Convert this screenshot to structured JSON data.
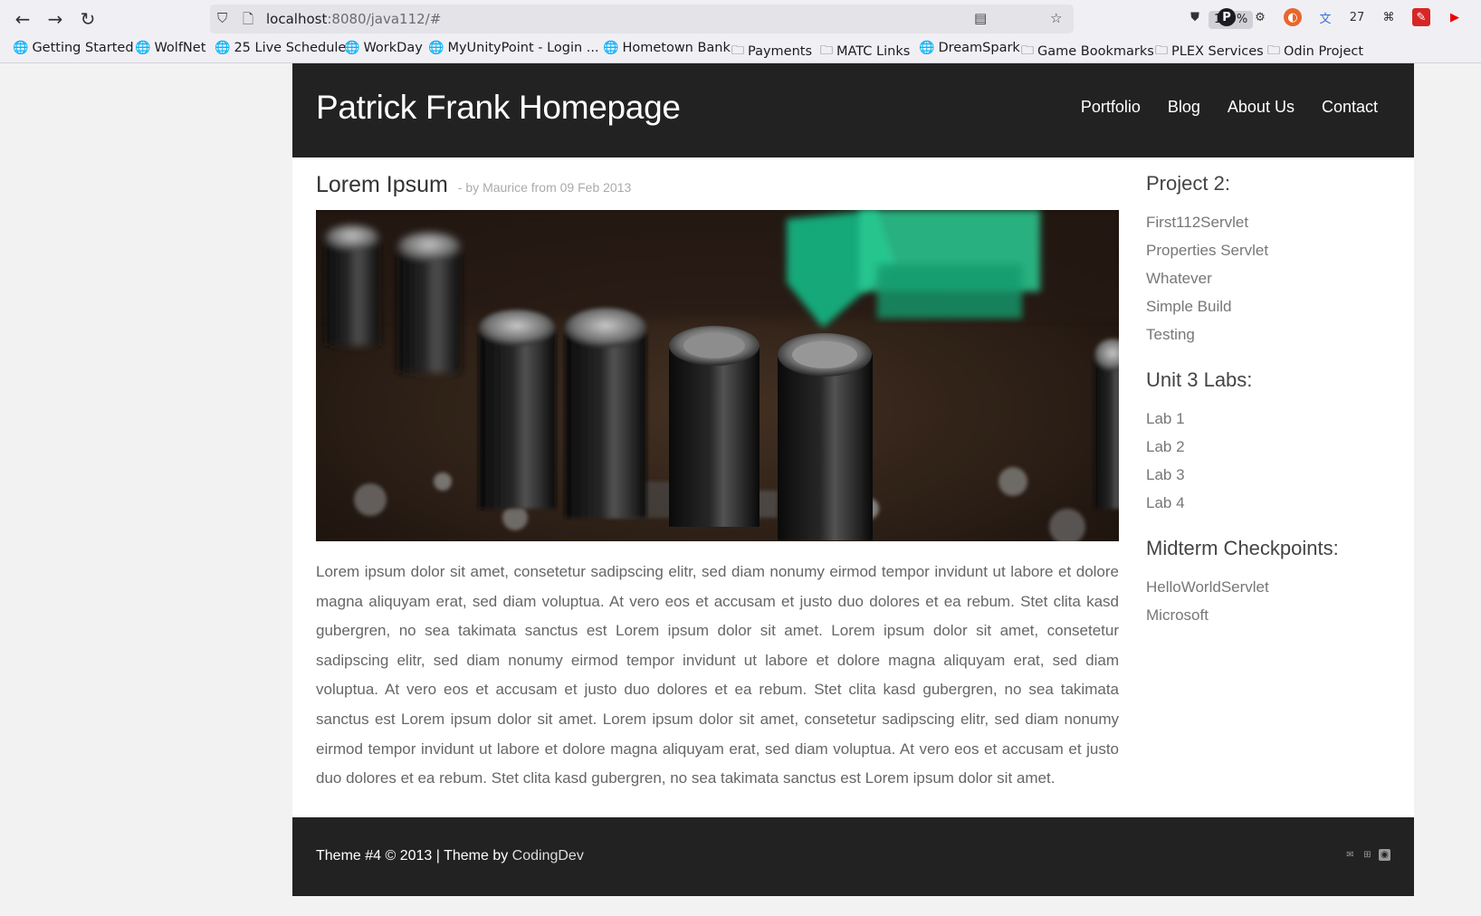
{
  "browser": {
    "url_host": "localhost",
    "url_path": ":8080/java112/#",
    "zoom": "130%",
    "bookmarks": [
      "Getting Started",
      "WolfNet",
      "25 Live Schedule",
      "WorkDay",
      "MyUnityPoint - Login ...",
      "Hometown Bank",
      "Payments",
      "MATC Links",
      "DreamSpark",
      "Game Bookmarks",
      "PLEX Services",
      "Odin Project"
    ]
  },
  "header": {
    "title": "Patrick Frank Homepage",
    "nav": [
      "Portfolio",
      "Blog",
      "About Us",
      "Contact"
    ]
  },
  "post": {
    "title": "Lorem Ipsum",
    "meta": "- by Maurice from 09 Feb 2013",
    "body": "Lorem ipsum dolor sit amet, consetetur sadipscing elitr, sed diam nonumy eirmod tempor invidunt ut labore et dolore magna aliquyam erat, sed diam voluptua. At vero eos et accusam et justo duo dolores et ea rebum. Stet clita kasd gubergren, no sea takimata sanctus est Lorem ipsum dolor sit amet. Lorem ipsum dolor sit amet, consetetur sadipscing elitr, sed diam nonumy eirmod tempor invidunt ut labore et dolore magna aliquyam erat, sed diam voluptua. At vero eos et accusam et justo duo dolores et ea rebum. Stet clita kasd gubergren, no sea takimata sanctus est Lorem ipsum dolor sit amet. Lorem ipsum dolor sit amet, consetetur sadipscing elitr, sed diam nonumy eirmod tempor invidunt ut labore et dolore magna aliquyam erat, sed diam voluptua. At vero eos et accusam et justo duo dolores et ea rebum. Stet clita kasd gubergren, no sea takimata sanctus est Lorem ipsum dolor sit amet."
  },
  "sidebar": {
    "sections": [
      {
        "heading": "Project 2:",
        "links": [
          "First112Servlet",
          "Properties Servlet",
          "Whatever",
          "Simple Build",
          "Testing"
        ]
      },
      {
        "heading": "Unit 3 Labs:",
        "links": [
          "Lab 1",
          "Lab 2",
          "Lab 3",
          "Lab 4"
        ]
      },
      {
        "heading": "Midterm Checkpoints:",
        "links": [
          "HelloWorldServlet",
          "Microsoft"
        ]
      }
    ]
  },
  "footer": {
    "text": "Theme #4 © 2013 | Theme by ",
    "link": "CodingDev",
    "icons": [
      "mail-icon",
      "sitemap-icon",
      "rss-icon"
    ]
  },
  "colors": {
    "header_bg": "#222222",
    "page_bg": "#f2f2f2"
  }
}
